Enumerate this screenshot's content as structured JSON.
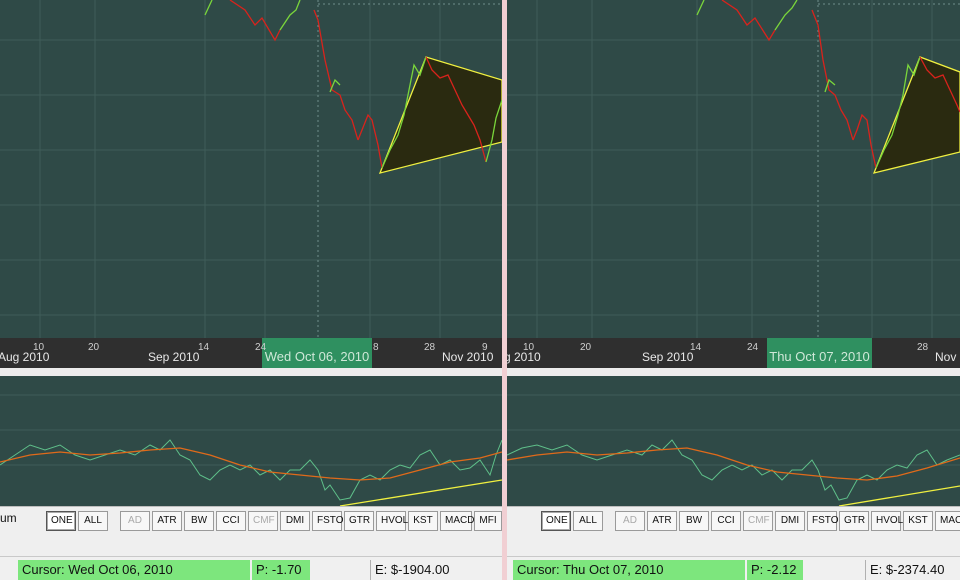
{
  "colors": {
    "chart_bg": "#2f4a47",
    "grid": "#3f5c58",
    "price_up": "#7ad63b",
    "price_down": "#d9231c",
    "triangle_fill": "#2a2a10",
    "trendline": "#f0f040",
    "oscillator": "#5fc08a",
    "signal": "#e06a1a",
    "status_green": "#7de67d",
    "cursor_date_bg": "#2f9060"
  },
  "left": {
    "cursor_date": "Wed Oct 06, 2010",
    "month_labels": [
      "Aug 2010",
      "Sep 2010",
      "Nov 2010"
    ],
    "day_labels": [
      "10",
      "20",
      "14",
      "24",
      "8",
      "28",
      "9"
    ],
    "toolbar_label": "um",
    "status": {
      "cursor": "Cursor: Wed Oct 06, 2010",
      "p": "P: -1.70",
      "e": "E: $-1904.00"
    }
  },
  "right": {
    "cursor_date": "Thu Oct 07, 2010",
    "month_labels": [
      "g 2010",
      "Sep 2010",
      "Nov"
    ],
    "day_labels": [
      "10",
      "20",
      "14",
      "24",
      "28"
    ],
    "status": {
      "cursor": "Cursor: Thu Oct 07, 2010",
      "p": "P: -2.12",
      "e": "E: $-2374.40"
    }
  },
  "toolbar_buttons": [
    "ONE",
    "ALL",
    "AD",
    "ATR",
    "BW",
    "CCI",
    "CMF",
    "DMI",
    "FSTO",
    "GTR",
    "HVOL",
    "KST",
    "MACD",
    "MFI"
  ]
}
